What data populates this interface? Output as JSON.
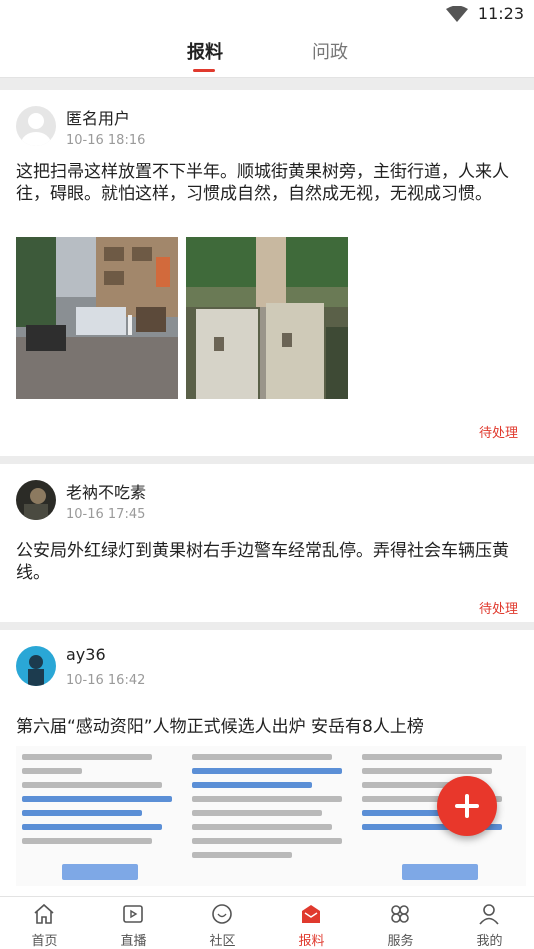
{
  "status_bar": {
    "time": "11:23"
  },
  "tabs": [
    {
      "label": "报料",
      "active": true
    },
    {
      "label": "问政",
      "active": false
    }
  ],
  "posts": [
    {
      "user": "匿名用户",
      "date": "10-16 18:16",
      "content": "这把扫帚这样放置不下半年。顺城街黄果树旁，主街行道，人来人往，碍眼。就怕这样，习惯成自然，自然成无视，无视成习惯。",
      "status": "待处理"
    },
    {
      "user": "老衲不吃素",
      "date": "10-16 17:45",
      "content": "公安局外红绿灯到黄果树右手边警车经常乱停。弄得社会车辆压黄线。",
      "status": "待处理"
    },
    {
      "user": "ay36",
      "date": "10-16 16:42",
      "content": "第六届“感动资阳”人物正式候选人出炉  安岳有8人上榜"
    }
  ],
  "bottom_nav": [
    {
      "label": "首页",
      "icon": "home-icon"
    },
    {
      "label": "直播",
      "icon": "live-icon"
    },
    {
      "label": "社区",
      "icon": "community-icon"
    },
    {
      "label": "报料",
      "icon": "report-icon",
      "active": true
    },
    {
      "label": "服务",
      "icon": "service-icon"
    },
    {
      "label": "我的",
      "icon": "profile-icon"
    }
  ],
  "colors": {
    "accent": "#e03a2e"
  }
}
